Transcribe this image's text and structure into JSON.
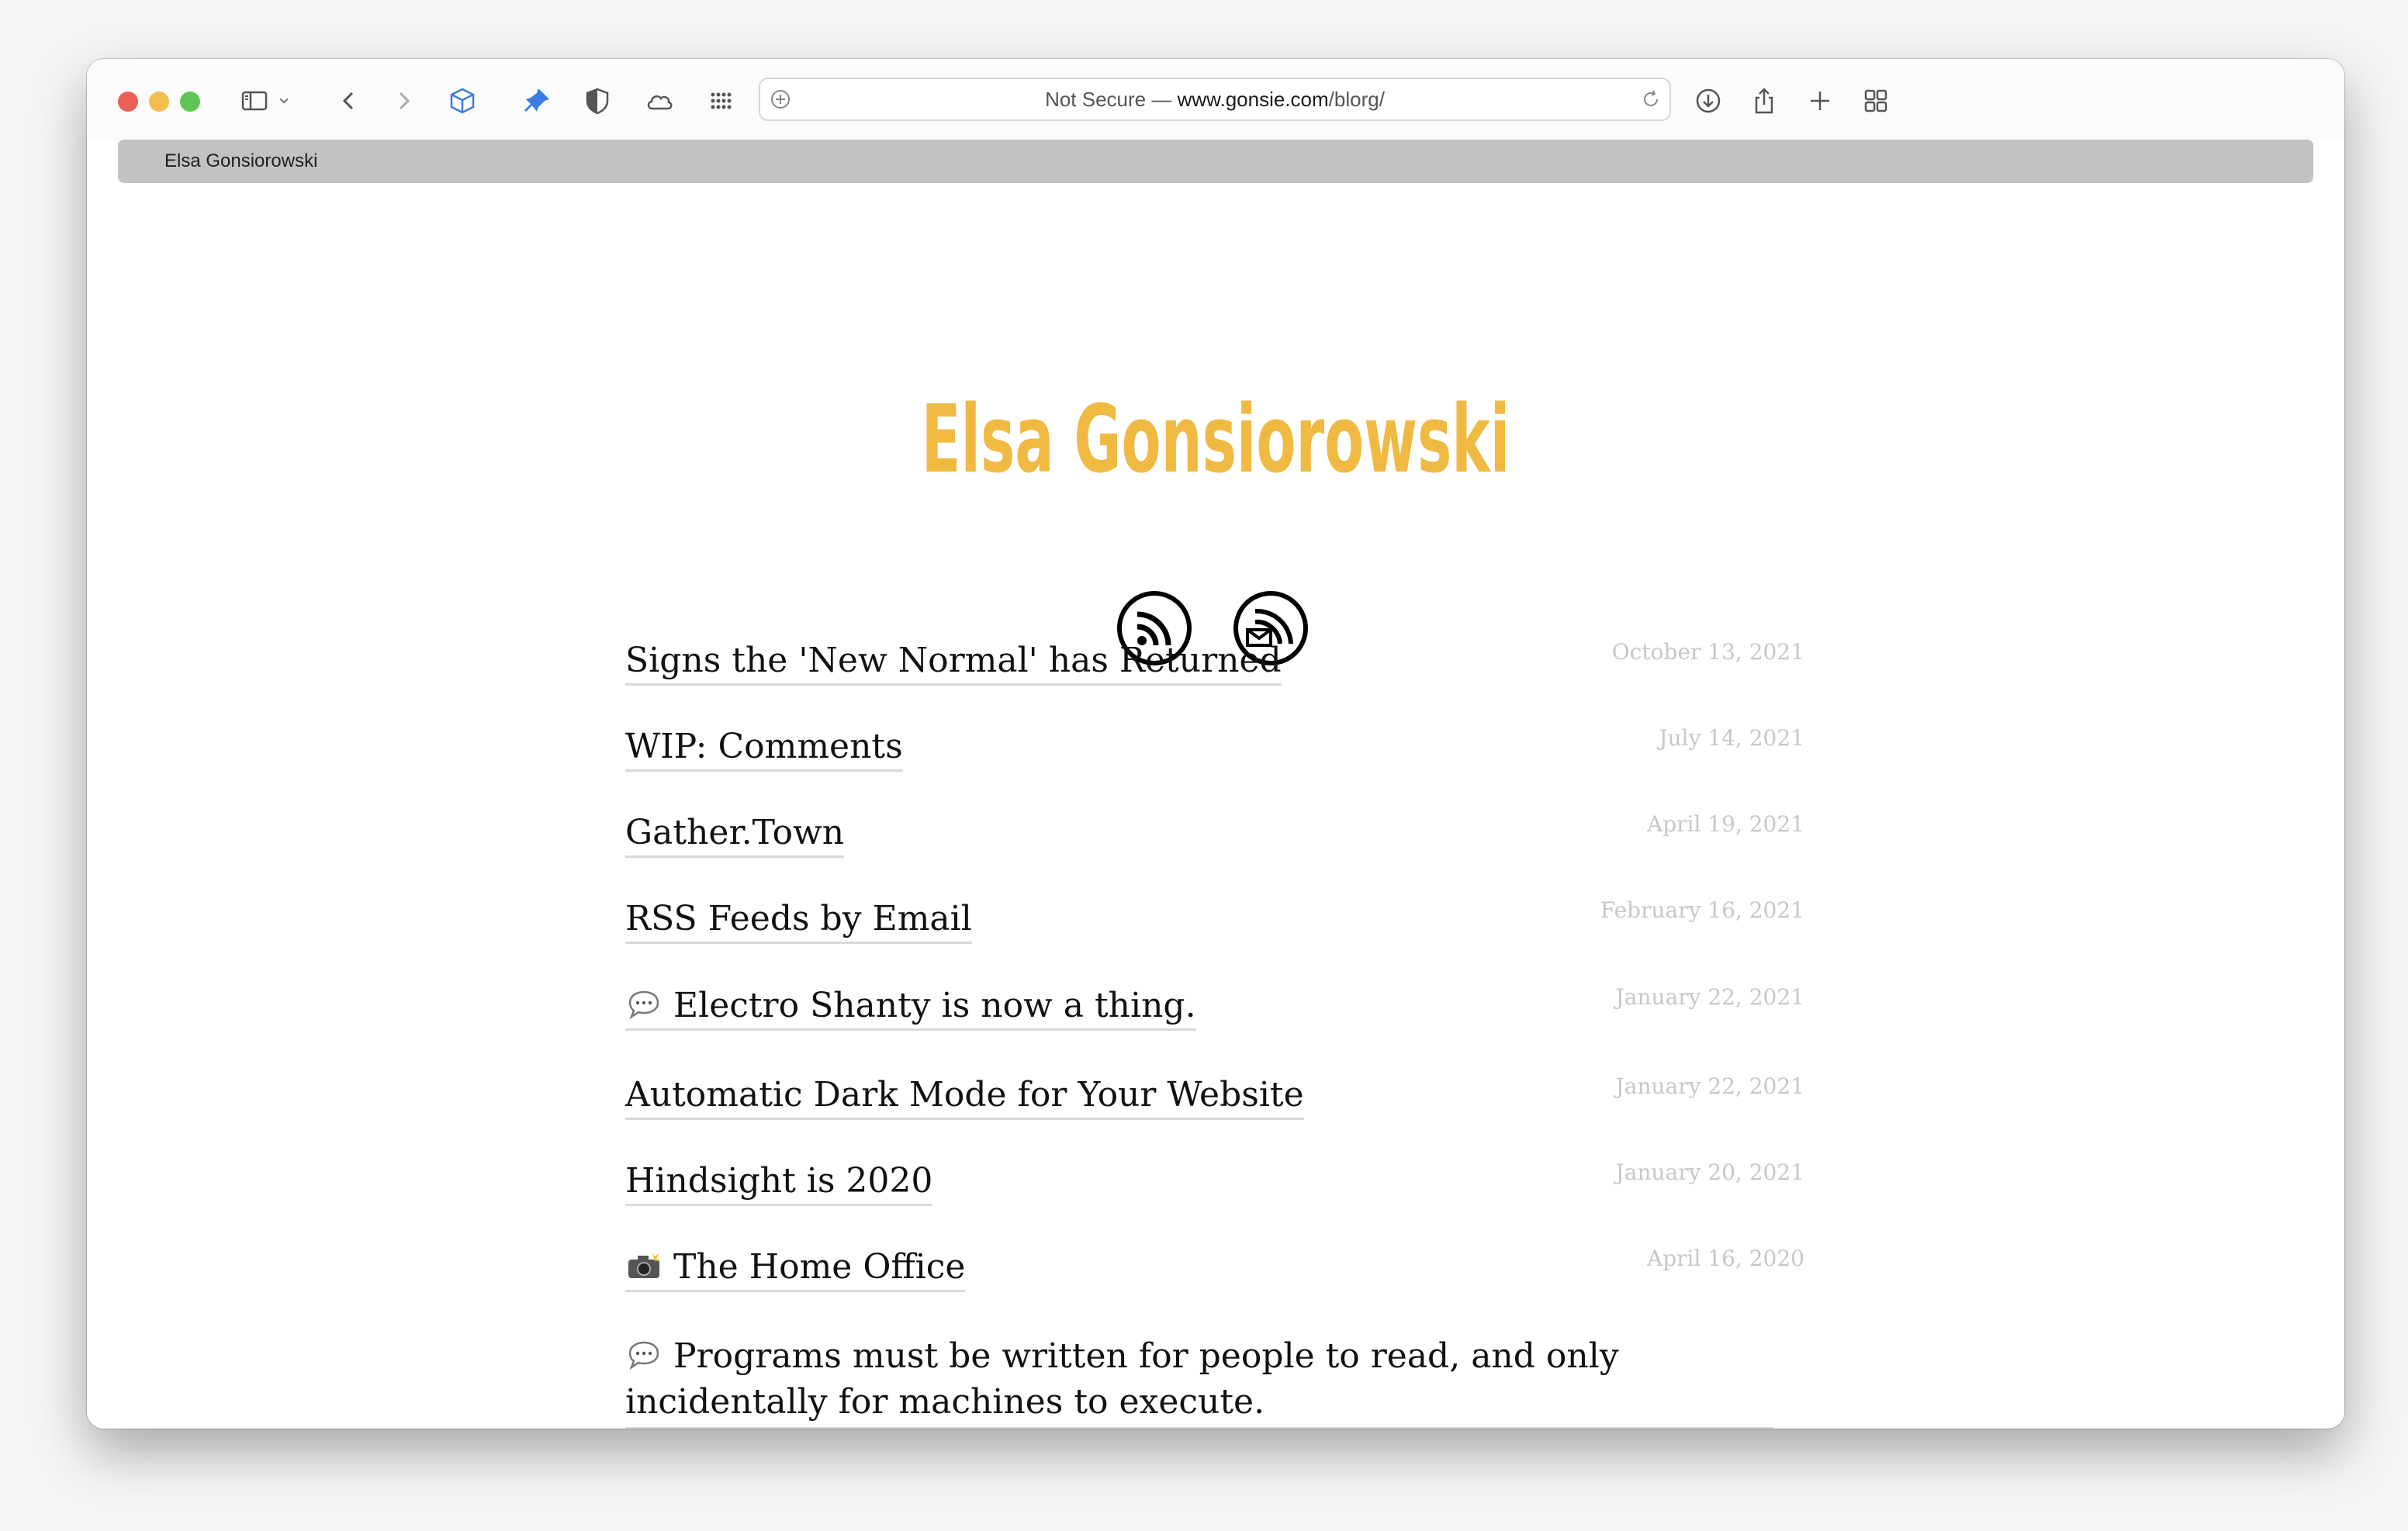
{
  "browser": {
    "url_prefix": "Not Secure — ",
    "url_host": "www.gonsie.com",
    "url_path": "/blorg/",
    "tab_title": "Elsa Gonsiorowski"
  },
  "site": {
    "title": "Elsa Gonsiorowski",
    "accent_color": "#f0b942",
    "icons": [
      "rss-feed-icon",
      "email-rss-icon"
    ]
  },
  "posts": [
    {
      "title": "Signs the 'New Normal' has Returned",
      "date": "October 13, 2021",
      "icon": ""
    },
    {
      "title": "WIP: Comments",
      "date": "July 14, 2021",
      "icon": ""
    },
    {
      "title": "Gather.Town",
      "date": "April 19, 2021",
      "icon": ""
    },
    {
      "title": "RSS Feeds by Email",
      "date": "February 16, 2021",
      "icon": ""
    },
    {
      "title": "Electro Shanty is now a thing.",
      "date": "January 22, 2021",
      "icon": "speech-bubble-icon"
    },
    {
      "title": "Automatic Dark Mode for Your Website",
      "date": "January 22, 2021",
      "icon": ""
    },
    {
      "title": "Hindsight is 2020",
      "date": "January 20, 2021",
      "icon": ""
    },
    {
      "title": "The Home Office",
      "date": "April 16, 2020",
      "icon": "camera-flash-icon"
    },
    {
      "title": "Programs must be written for people to read, and only incidentally for machines to execute.",
      "date": "",
      "icon": "speech-bubble-icon"
    }
  ]
}
